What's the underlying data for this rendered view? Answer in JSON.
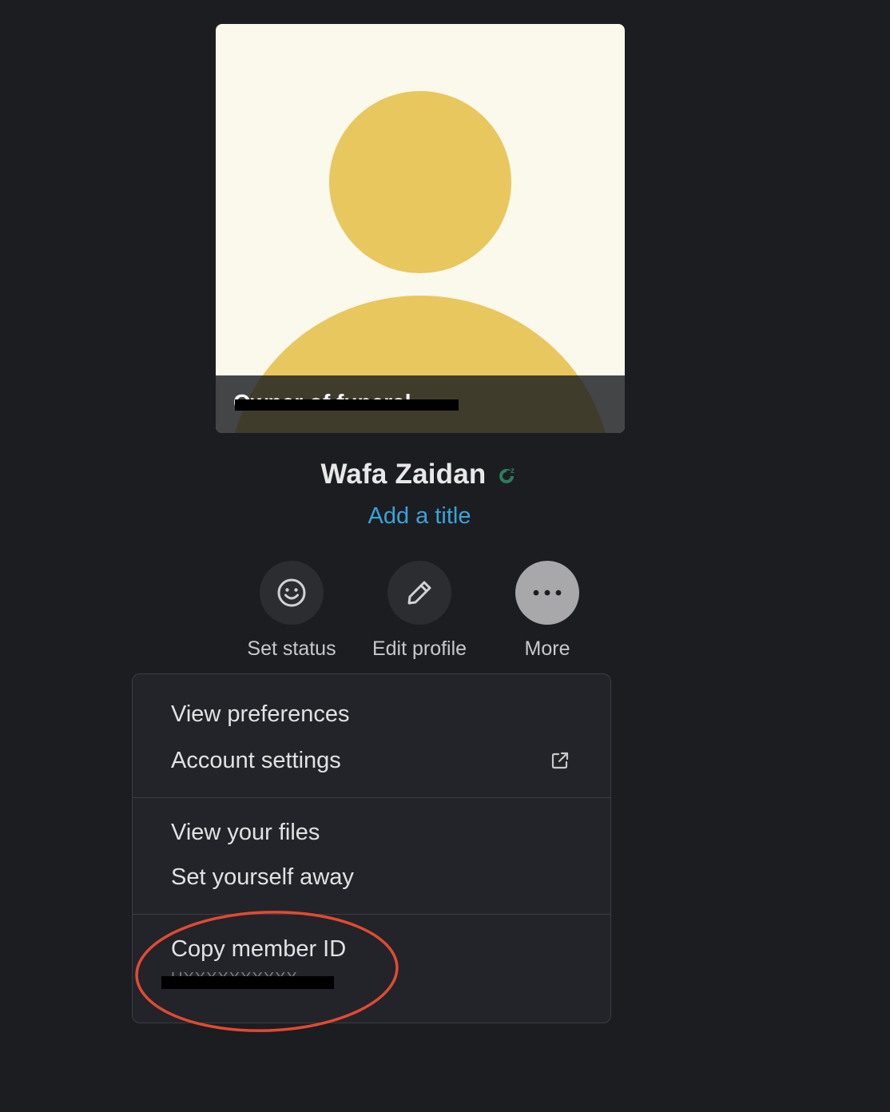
{
  "profile": {
    "avatar_overlay_text": "Owner of funeral",
    "name": "Wafa Zaidan",
    "add_title": "Add a title",
    "avatar_colors": {
      "background": "#fbf9ec",
      "figure": "#e9c75f"
    },
    "status_color": "#2e7d5b"
  },
  "actions": {
    "set_status": "Set status",
    "edit_profile": "Edit profile",
    "more": "More"
  },
  "menu": {
    "view_preferences": "View preferences",
    "account_settings": "Account settings",
    "view_your_files": "View your files",
    "set_yourself_away": "Set yourself away",
    "copy_member_id": "Copy member ID",
    "member_id_value": "UXXXXXXXXXX"
  },
  "annotation_color": "#e24a33"
}
